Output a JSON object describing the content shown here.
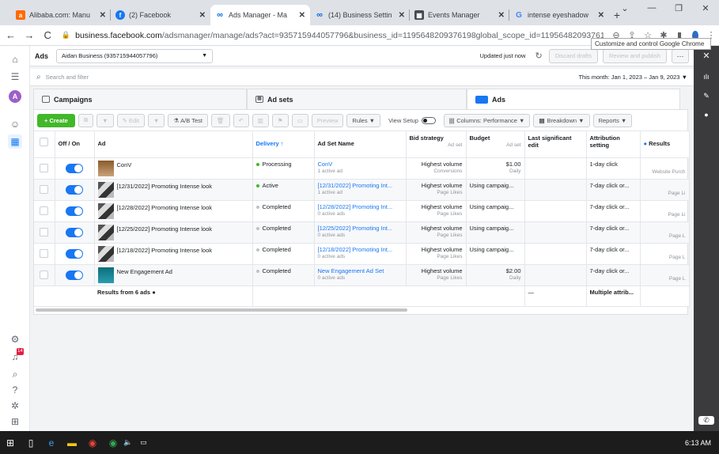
{
  "browser": {
    "tabs": [
      {
        "label": "Alibaba.com: Manu",
        "icon": "alibaba-icon",
        "color": "#ff6a00",
        "active": false
      },
      {
        "label": "(2) Facebook",
        "icon": "facebook-icon",
        "color": "#1877f2",
        "active": false
      },
      {
        "label": "Ads Manager - Ma",
        "icon": "meta-icon",
        "color": "#0668e1",
        "active": true
      },
      {
        "label": "(14) Business Settin",
        "icon": "meta-icon",
        "color": "#0668e1",
        "active": false
      },
      {
        "label": "Events Manager",
        "icon": "events-manager-icon",
        "color": "#444950",
        "active": false
      },
      {
        "label": "intense eyeshadow",
        "icon": "google-icon",
        "color": "#4285f4",
        "active": false
      }
    ],
    "url_host": "business.facebook.com",
    "url_path": "/adsmanager/manage/ads?act=935715944057796&business_id=1195648209376198global_scope_id=11956482093761...",
    "tooltip": "Customize and control Google Chrome"
  },
  "topbar": {
    "title": "Ads",
    "account": "Aidan Business (935715944057796)",
    "updated": "Updated just now",
    "discard": "Discard drafts",
    "review": "Review and publish",
    "more": "···"
  },
  "search": {
    "placeholder": "Search and filter",
    "daterange": "This month: Jan 1, 2023 – Jan 9, 2023"
  },
  "level_tabs": {
    "campaigns": "Campaigns",
    "adsets": "Ad sets",
    "ads": "Ads"
  },
  "toolbar": {
    "create": "+ Create",
    "edit": "Edit",
    "abtest": "A/B Test",
    "preview": "Preview",
    "rules": "Rules",
    "view_setup": "View Setup",
    "columns": "Columns: Performance",
    "breakdown": "Breakdown",
    "reports": "Reports"
  },
  "columns": {
    "onoff": "Off / On",
    "ad": "Ad",
    "delivery": "Delivery ↑",
    "adset": "Ad Set Name",
    "bid": "Bid strategy",
    "bid_sub": "Ad set",
    "budget": "Budget",
    "budget_sub": "Ad set",
    "last_edit": "Last significant edit",
    "attribution": "Attribution setting",
    "results": "Results"
  },
  "rows": [
    {
      "ad": "ConV",
      "delivery": "Processing",
      "adset": "ConV",
      "adset_meta": "1 active ad",
      "bid": "Highest volume",
      "bid_meta": "Conversions",
      "budget": "$1.00",
      "budget_meta": "Daily",
      "attribution": "1-day click",
      "results": "Website Purch"
    },
    {
      "ad": "[12/31/2022] Promoting Intense look",
      "delivery": "Active",
      "adset": "[12/31/2022] Promoting Int...",
      "adset_meta": "1 active ad",
      "bid": "Highest volume",
      "bid_meta": "Page Likes",
      "budget": "Using campaig...",
      "budget_meta": "",
      "attribution": "7-day click or...",
      "results": "Page Li"
    },
    {
      "ad": "[12/28/2022] Promoting Intense look",
      "delivery": "Completed",
      "adset": "[12/28/2022] Promoting Int...",
      "adset_meta": "0 active ads",
      "bid": "Highest volume",
      "bid_meta": "Page Likes",
      "budget": "Using campaig...",
      "budget_meta": "",
      "attribution": "7-day click or...",
      "results": "Page Li"
    },
    {
      "ad": "[12/25/2022] Promoting Intense look",
      "delivery": "Completed",
      "adset": "[12/25/2022] Promoting Int...",
      "adset_meta": "0 active ads",
      "bid": "Highest volume",
      "bid_meta": "Page Likes",
      "budget": "Using campaig...",
      "budget_meta": "",
      "attribution": "7-day click or...",
      "results": "Page L"
    },
    {
      "ad": "[12/18/2022] Promoting Intense look",
      "delivery": "Completed",
      "adset": "[12/18/2022] Promoting Int...",
      "adset_meta": "0 active ads",
      "bid": "Highest volume",
      "bid_meta": "Page Likes",
      "budget": "Using campaig...",
      "budget_meta": "",
      "attribution": "7-day click or...",
      "results": "Page L"
    },
    {
      "ad": "New Engagement Ad",
      "delivery": "Completed",
      "adset": "New Engagement Ad Set",
      "adset_meta": "0 active ads",
      "bid": "Highest volume",
      "bid_meta": "Page Likes",
      "budget": "$2.00",
      "budget_meta": "Daily",
      "attribution": "7-day click or...",
      "results": "Page L"
    }
  ],
  "summary": {
    "label": "Results from 6 ads",
    "last_edit": "—",
    "attribution": "Multiple attrib..."
  },
  "rail": {
    "account_initial": "A",
    "notifications": "14"
  },
  "taskbar": {
    "time": "6:13 AM"
  },
  "colors": {
    "accent": "#1877f2",
    "create": "#42b72a"
  }
}
